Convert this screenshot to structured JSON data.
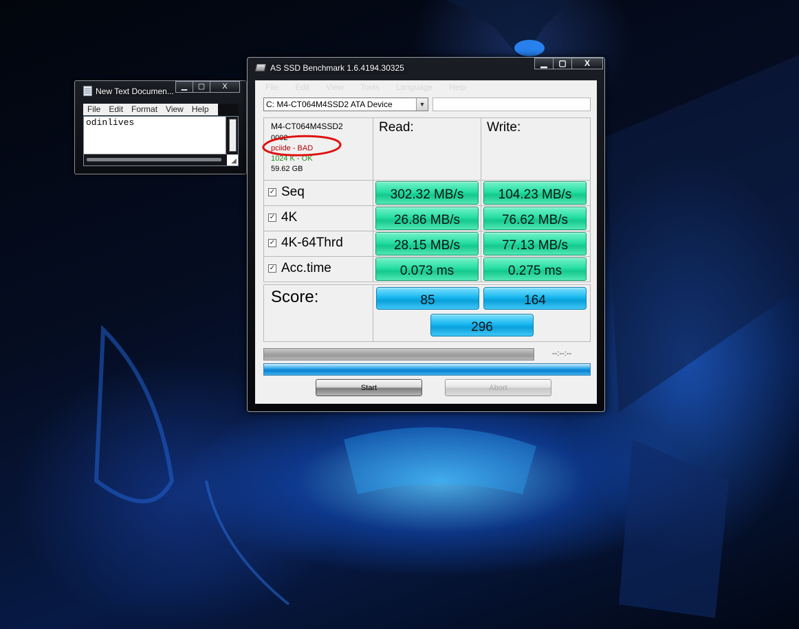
{
  "notepad": {
    "title": "New Text Documen...",
    "controls": {
      "minimize": "▁",
      "maximize": "▢",
      "close": "X"
    },
    "menu": [
      "File",
      "Edit",
      "Format",
      "View",
      "Help"
    ],
    "content": "odinlives"
  },
  "ssd": {
    "title": "AS SSD Benchmark 1.6.4194.30325",
    "controls": {
      "minimize": "▁",
      "maximize": "▢",
      "close": "X"
    },
    "menu": [
      "File",
      "Edit",
      "View",
      "Tools",
      "Language",
      "Help"
    ],
    "device": "C: M4-CT064M4SSD2 ATA Device",
    "info": {
      "model": "M4-CT064M4SSD2",
      "firmware": "0002",
      "driver": "pciide - BAD",
      "alignment": "1024 K - OK",
      "size": "59.62 GB"
    },
    "headers": {
      "read": "Read:",
      "write": "Write:"
    },
    "rows": [
      {
        "label": "Seq",
        "checked": true,
        "read": "302.32 MB/s",
        "write": "104.23 MB/s"
      },
      {
        "label": "4K",
        "checked": true,
        "read": "26.86 MB/s",
        "write": "76.62 MB/s"
      },
      {
        "label": "4K-64Thrd",
        "checked": true,
        "read": "28.15 MB/s",
        "write": "77.13 MB/s"
      },
      {
        "label": "Acc.time",
        "checked": true,
        "read": "0.073 ms",
        "write": "0.275 ms"
      }
    ],
    "score": {
      "label": "Score:",
      "read": "85",
      "write": "164",
      "total": "296"
    },
    "elapsed": "--:--:--",
    "buttons": {
      "start": "Start",
      "abort": "Abort"
    },
    "colors": {
      "value_green": "#27dea3",
      "score_blue": "#18b8f0",
      "bad": "#b00000",
      "ok": "#1a8a1a"
    }
  }
}
